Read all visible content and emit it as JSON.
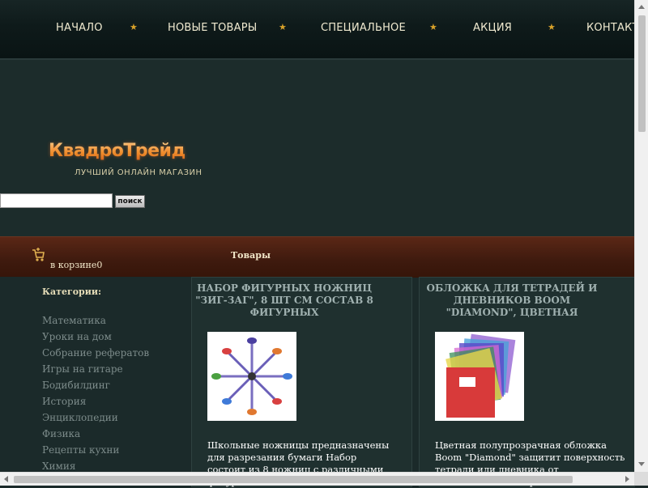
{
  "nav": {
    "items": [
      "НАЧАЛО",
      "НОВЫЕ ТОВАРЫ",
      "СПЕЦИАЛЬНОЕ",
      "АКЦИЯ",
      "КОНТАКТЫ"
    ],
    "separator_icon": "star-icon"
  },
  "header": {
    "logo_text": "КвадроТрейд",
    "tagline": "ЛУЧШИЙ ОНЛАЙН МАГАЗИН"
  },
  "search": {
    "value": "",
    "button_label": "поиск"
  },
  "bar": {
    "cart_text": "в корзине0",
    "goods_title": "Товары"
  },
  "sidebar": {
    "title": "Категории:",
    "items": [
      "Математика",
      "Уроки на дом",
      "Собрание рефератов",
      "Игры на гитаре",
      "Бодибилдинг",
      "История",
      "Энциклопедии",
      "Физика",
      "Рецепты кухни",
      "Химия"
    ]
  },
  "products": [
    {
      "title": "НАБОР ФИГУРНЫХ НОЖНИЦ \"ЗИГ-ЗАГ\", 8 ШТ СМ СОСТАВ 8 ФИГУРНЫХ",
      "image": "scissors-icon",
      "description": "Школьные ножницы предназначены для разрезания бумаги Набор состоит из 8 ножниц с различными фигурными лезвиями"
    },
    {
      "title": "ОБЛОЖКА ДЛЯ ТЕТРАДЕЙ И ДНЕВНИКОВ BOOM \"DIAMOND\", ЦВЕТНАЯ",
      "image": "notebook-covers-icon",
      "description": "Цветная полупрозрачная обложка Boom \"Diamond\" защитит поверхность тетради или дневника от изнашивания и загрязнений"
    }
  ],
  "colors": {
    "nav_text": "#f0ead0",
    "star": "#d8a22a",
    "brown_bar": "#4a1f10",
    "category_text": "#7d8c8b"
  }
}
